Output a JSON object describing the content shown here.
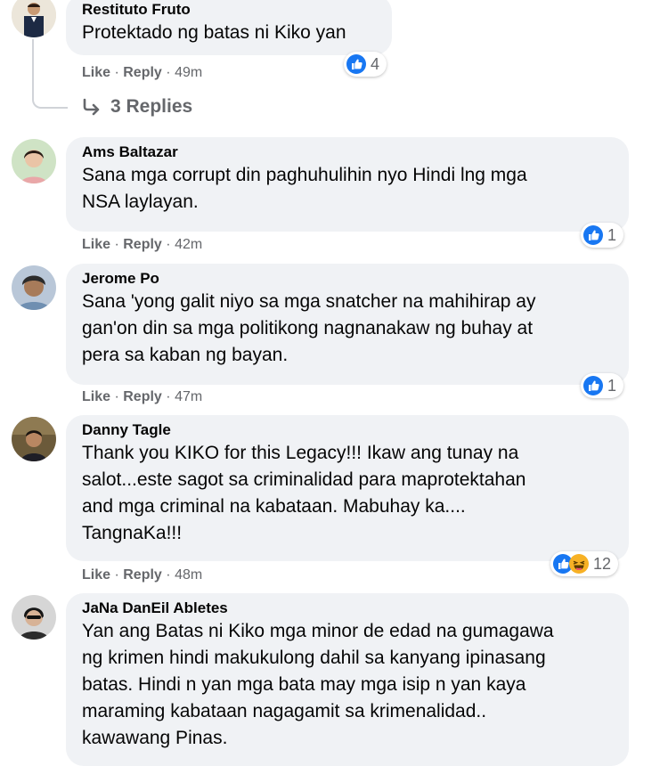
{
  "actions": {
    "like": "Like",
    "reply": "Reply",
    "sep": "·"
  },
  "comments": [
    {
      "author": "Restituto Fruto",
      "lines": [
        "Protektado ng batas ni Kiko yan"
      ],
      "time": "49m",
      "reactions": {
        "icons": [
          "like-icon"
        ],
        "count": "4"
      },
      "replies_label": "3 Replies"
    },
    {
      "author": "Ams Baltazar",
      "lines": [
        "Sana mga corrupt din paghuhulihin nyo Hindi lng mga",
        "NSA laylayan."
      ],
      "time": "42m",
      "reactions": {
        "icons": [
          "like-icon"
        ],
        "count": "1"
      }
    },
    {
      "author": "Jerome Po",
      "lines": [
        "Sana 'yong galit niyo sa mga snatcher na mahihirap ay",
        "gan'on din sa mga politikong nagnanakaw ng buhay at",
        "pera sa kaban ng bayan."
      ],
      "time": "47m",
      "reactions": {
        "icons": [
          "like-icon"
        ],
        "count": "1"
      }
    },
    {
      "author": "Danny Tagle",
      "lines": [
        "Thank you KIKO for this Legacy!!! Ikaw ang tunay na",
        "salot...este sagot sa criminalidad para maprotektahan",
        "and mga criminal na kabataan. Mabuhay ka....",
        "TangnaKa!!!"
      ],
      "time": "48m",
      "reactions": {
        "icons": [
          "like-icon",
          "haha-icon"
        ],
        "count": "12"
      }
    },
    {
      "author": "JaNa DanEil Abletes",
      "lines": [
        "Yan ang Batas ni Kiko mga minor de edad na gumagawa",
        "ng krimen hindi makukulong dahil sa kanyang ipinasang",
        "batas. Hindi n yan mga bata may mga isip n yan kaya",
        "maraming kabataan nagagamit sa krimenalidad..",
        "kawawang Pinas."
      ]
    }
  ],
  "colors": {
    "bubble": "#f0f2f5",
    "like_blue": "#1877f2",
    "meta_gray": "#65676b",
    "text": "#050505"
  }
}
